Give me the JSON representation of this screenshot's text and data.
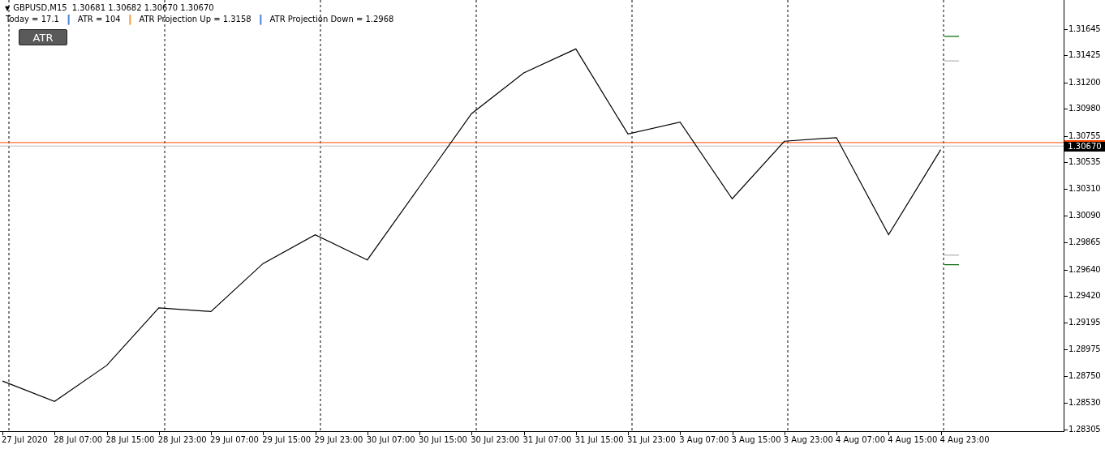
{
  "header": {
    "menu_icon": "▼",
    "symbol": "GBPUSD,M15",
    "quotes": "1.30681 1.30682 1.30670 1.30670"
  },
  "indicator": {
    "values": [
      "Today = 17.1",
      "ATR = 104",
      "ATR Projection Up = 1.3158",
      "ATR Projection Down = 1.2968"
    ],
    "separators": [
      {
        "text": "|",
        "color": "#4a86d8"
      },
      {
        "text": "|",
        "color": "#f0a040"
      },
      {
        "text": "|",
        "color": "#4a86d8"
      }
    ]
  },
  "atr_button": {
    "label": "ATR"
  },
  "chart": {
    "chart_data": {
      "type": "line",
      "categories": [
        "27 Jul 2020",
        "28 Jul 07:00",
        "28 Jul 15:00",
        "28 Jul 23:00",
        "29 Jul 07:00",
        "29 Jul 15:00",
        "29 Jul 23:00",
        "30 Jul 07:00",
        "30 Jul 15:00",
        "30 Jul 23:00",
        "31 Jul 07:00",
        "31 Jul 15:00",
        "31 Jul 23:00",
        "3 Aug 07:00",
        "3 Aug 15:00",
        "3 Aug 23:00",
        "4 Aug 07:00",
        "4 Aug 15:00",
        "4 Aug 23:00"
      ],
      "ref_lines": [
        {
          "axis": "y",
          "value": 1.30699,
          "color": "#ff4500"
        },
        {
          "axis": "y",
          "value": 1.3067,
          "label": "1.30670",
          "color": "#c0c0c0"
        }
      ],
      "series": [
        {
          "color": "#000000",
          "values": [
            1.2871,
            1.2854,
            1.2884,
            1.2932,
            1.2929,
            1.2969,
            1.2993,
            1.2972,
            1.3033,
            1.3094,
            1.3128,
            1.3148,
            1.3077,
            1.3087,
            1.3023,
            1.3071,
            1.3074,
            1.2993,
            1.3064
          ]
        }
      ],
      "ylim": [
        1.28285,
        1.31888
      ],
      "yticks": [
        {
          "value": 1.31645,
          "label": "1.31645"
        },
        {
          "value": 1.31425,
          "label": "1.31425"
        },
        {
          "value": 1.312,
          "label": "1.31200"
        },
        {
          "value": 1.3098,
          "label": "1.30980"
        },
        {
          "value": 1.30755,
          "label": "1.30755"
        },
        {
          "value": 1.30535,
          "label": "1.30535"
        },
        {
          "value": 1.3031,
          "label": "1.30310"
        },
        {
          "value": 1.3009,
          "label": "1.30090"
        },
        {
          "value": 1.29865,
          "label": "1.29865"
        },
        {
          "value": 1.2964,
          "label": "1.29640"
        },
        {
          "value": 1.2942,
          "label": "1.29420"
        },
        {
          "value": 1.29195,
          "label": "1.29195"
        },
        {
          "value": 1.28975,
          "label": "1.28975"
        },
        {
          "value": 1.2875,
          "label": "1.28750"
        },
        {
          "value": 1.2853,
          "label": "1.28530"
        },
        {
          "value": 1.28305,
          "label": "1.28305"
        }
      ]
    }
  }
}
